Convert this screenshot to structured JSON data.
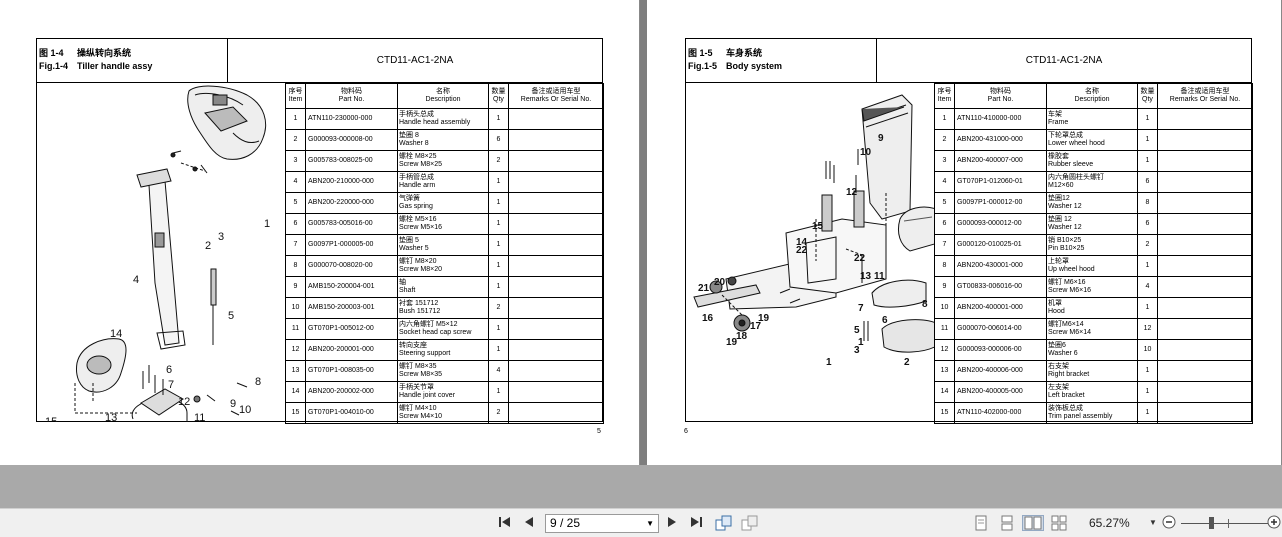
{
  "left_page": {
    "fig_cn": "图 1-4",
    "title_cn": "操纵转向系统",
    "fig_en": "Fig.1-4",
    "title_en": "Tiller handle assy",
    "model": "CTD11-AC1-2NA",
    "page_number": "5",
    "columns": {
      "no_cn": "序号",
      "no_en": "Item",
      "pn_cn": "物料码",
      "pn_en": "Part No.",
      "desc_cn": "名称",
      "desc_en": "Description",
      "qty_cn": "数量",
      "qty_en": "Qty",
      "rem_cn": "备注或适用车型",
      "rem_en": "Remarks Or Serial No."
    },
    "rows": [
      {
        "no": "1",
        "pn": "ATN110-230000-000",
        "cn": "手柄头总成",
        "en": "Handle head assembly",
        "qty": "1"
      },
      {
        "no": "2",
        "pn": "G000093-000008-00",
        "cn": "垫圈 8",
        "en": "Washer 8",
        "qty": "6"
      },
      {
        "no": "3",
        "pn": "G005783-008025-00",
        "cn": "螺栓 M8×25",
        "en": "Screw M8×25",
        "qty": "2"
      },
      {
        "no": "4",
        "pn": "ABN200-210000-000",
        "cn": "手柄管总成",
        "en": "Handle arm",
        "qty": "1"
      },
      {
        "no": "5",
        "pn": "ABN200-220000-000",
        "cn": "气弹簧",
        "en": "Gas spring",
        "qty": "1"
      },
      {
        "no": "6",
        "pn": "G005783-005016-00",
        "cn": "螺栓 M5×16",
        "en": "Screw M5×16",
        "qty": "1"
      },
      {
        "no": "7",
        "pn": "G0097P1-000005-00",
        "cn": "垫圈 5",
        "en": "Washer 5",
        "qty": "1"
      },
      {
        "no": "8",
        "pn": "G000070-008020-00",
        "cn": "螺钉 M8×20",
        "en": "Screw M8×20",
        "qty": "1"
      },
      {
        "no": "9",
        "pn": "AMB150-200004-001",
        "cn": "轴",
        "en": "Shaft",
        "qty": "1"
      },
      {
        "no": "10",
        "pn": "AMB150-200003-001",
        "cn": "衬套 151712",
        "en": "Bush 151712",
        "qty": "2"
      },
      {
        "no": "11",
        "pn": "GT070P1-005012-00",
        "cn": "内六角螺钉 M5×12",
        "en": "Socket head cap screw",
        "qty": "1"
      },
      {
        "no": "12",
        "pn": "ABN200-200001-000",
        "cn": "转向支座",
        "en": "Steering support",
        "qty": "1"
      },
      {
        "no": "13",
        "pn": "GT070P1-008035-00",
        "cn": "螺钉 M8×35",
        "en": "Screw M8×35",
        "qty": "4"
      },
      {
        "no": "14",
        "pn": "ABN200-200002-000",
        "cn": "手柄关节罩",
        "en": "Handle joint cover",
        "qty": "1"
      },
      {
        "no": "15",
        "pn": "GT070P1-004010-00",
        "cn": "螺钉 M4×10",
        "en": "Screw M4×10",
        "qty": "2"
      }
    ],
    "callouts": [
      "1",
      "2",
      "3",
      "4",
      "5",
      "6",
      "7",
      "8",
      "9",
      "10",
      "11",
      "12",
      "13",
      "14",
      "15",
      "2",
      "3"
    ]
  },
  "right_page": {
    "fig_cn": "图 1-5",
    "title_cn": "车身系统",
    "fig_en": "Fig.1-5",
    "title_en": "Body system",
    "model": "CTD11-AC1-2NA",
    "page_number": "6",
    "columns": {
      "no_cn": "序号",
      "no_en": "Item",
      "pn_cn": "物料码",
      "pn_en": "Part No.",
      "desc_cn": "名称",
      "desc_en": "Description",
      "qty_cn": "数量",
      "qty_en": "Qty",
      "rem_cn": "备注或适用车型",
      "rem_en": "Remarks Or Serial No."
    },
    "rows": [
      {
        "no": "1",
        "pn": "ATN110-410000-000",
        "cn": "车架",
        "en": "Frame",
        "qty": "1"
      },
      {
        "no": "2",
        "pn": "ABN200-431000-000",
        "cn": "下轮罩总成",
        "en": "Lower wheel hood",
        "qty": "1"
      },
      {
        "no": "3",
        "pn": "ABN200-400007-000",
        "cn": "橡胶套",
        "en": "Rubber sleeve",
        "qty": "1"
      },
      {
        "no": "4",
        "pn": "GT070P1-012060-01",
        "cn": "内六角圆柱头螺钉",
        "en": "M12×60",
        "qty": "6"
      },
      {
        "no": "5",
        "pn": "G0097P1-000012-00",
        "cn": "垫圈12",
        "en": "Washer 12",
        "qty": "8"
      },
      {
        "no": "6",
        "pn": "G000093-000012-00",
        "cn": "垫圈 12",
        "en": "Washer 12",
        "qty": "6"
      },
      {
        "no": "7",
        "pn": "G000120-010025-01",
        "cn": "销 B10×25",
        "en": "Pin B10×25",
        "qty": "2"
      },
      {
        "no": "8",
        "pn": "ABN200-430001-000",
        "cn": "上轮罩",
        "en": "Up wheel hood",
        "qty": "1"
      },
      {
        "no": "9",
        "pn": "GT00833-006016-00",
        "cn": "螺钉 M6×16",
        "en": "Screw M6×16",
        "qty": "4"
      },
      {
        "no": "10",
        "pn": "ABN200-400001-000",
        "cn": "机罩",
        "en": "Hood",
        "qty": "1"
      },
      {
        "no": "11",
        "pn": "G000070-006014-00",
        "cn": "螺钉M6×14",
        "en": "Screw M6×14",
        "qty": "12"
      },
      {
        "no": "12",
        "pn": "G000093-000006-00",
        "cn": "垫圈6",
        "en": "Washer 6",
        "qty": "10"
      },
      {
        "no": "13",
        "pn": "ABN200-400006-000",
        "cn": "右支架",
        "en": "Right bracket",
        "qty": "1"
      },
      {
        "no": "14",
        "pn": "ABN200-400005-000",
        "cn": "左支架",
        "en": "Left bracket",
        "qty": "1"
      },
      {
        "no": "15",
        "pn": "ATN110-402000-000",
        "cn": "装饰板总成",
        "en": "Trim panel assembly",
        "qty": "1"
      }
    ]
  },
  "toolbar": {
    "page_field": "9 / 25",
    "zoom": "65.27%"
  }
}
